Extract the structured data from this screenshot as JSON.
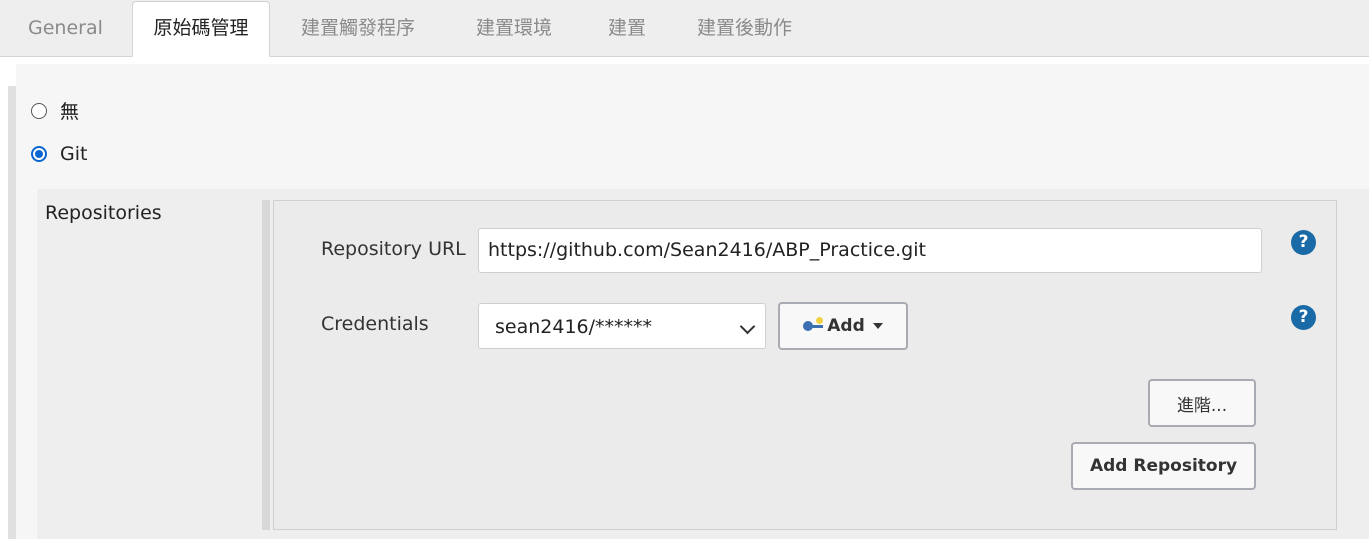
{
  "tabs": [
    {
      "label": "General",
      "active": false
    },
    {
      "label": "原始碼管理",
      "active": true
    },
    {
      "label": "建置觸發程序",
      "active": false
    },
    {
      "label": "建置環境",
      "active": false
    },
    {
      "label": "建置",
      "active": false
    },
    {
      "label": "建置後動作",
      "active": false
    }
  ],
  "scm": {
    "options": [
      {
        "label": "無",
        "checked": false
      },
      {
        "label": "Git",
        "checked": true
      }
    ],
    "repositories_label": "Repositories",
    "repository_url_label": "Repository URL",
    "repository_url_value": "https://github.com/Sean2416/ABP_Practice.git",
    "credentials_label": "Credentials",
    "credentials_selected": "sean2416/******",
    "add_button_label": "Add",
    "advanced_button_label": "進階...",
    "add_repository_button_label": "Add Repository",
    "help_icon_glyph": "?"
  },
  "colors": {
    "accent": "#0a66d0",
    "help_icon": "#1b6aa8"
  },
  "icons": {
    "credentials_add": "key-icon",
    "dropdown": "caret-down-icon",
    "help": "help-icon"
  }
}
